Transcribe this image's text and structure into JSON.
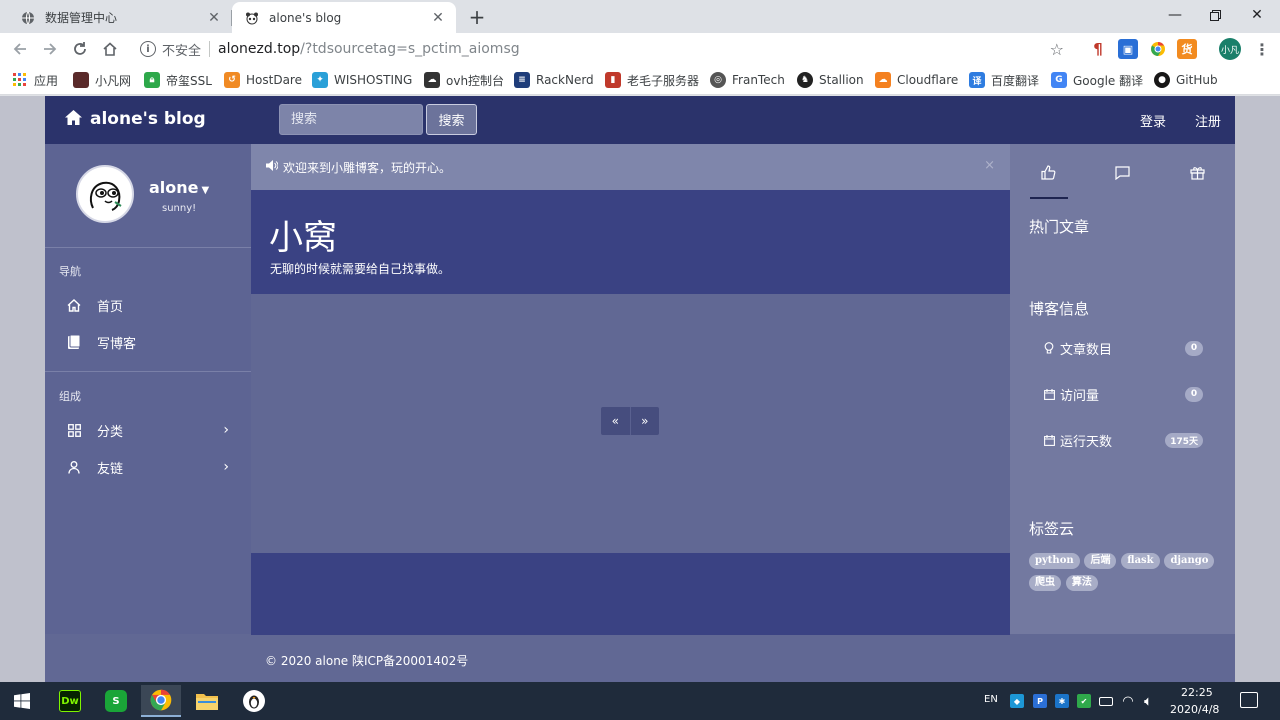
{
  "browser": {
    "tabs": [
      {
        "title": "数据管理中心",
        "icon": "globe-icon"
      },
      {
        "title": "alone's blog",
        "icon": "panda-icon"
      }
    ],
    "url": {
      "security_label": "不安全",
      "host": "alonezd.top",
      "path": "/?tdsourcetag=s_pctim_aiomsg"
    },
    "profile_initials": "小凡",
    "bookmarks": [
      {
        "label": "应用",
        "icon": "apps-grid-icon",
        "color": "#4285f4"
      },
      {
        "label": "小凡网",
        "icon": "site-icon",
        "color": "#5a2a2a"
      },
      {
        "label": "帝玺SSL",
        "icon": "lock-icon",
        "color": "#2da84a"
      },
      {
        "label": "HostDare",
        "icon": "flame-icon",
        "color": "#f08a24"
      },
      {
        "label": "WISHOSTING",
        "icon": "cloud-icon",
        "color": "#2aa0d8"
      },
      {
        "label": "ovh控制台",
        "icon": "cloud-icon",
        "color": "#333333"
      },
      {
        "label": "RackNerd",
        "icon": "server-icon",
        "color": "#1f3d7a"
      },
      {
        "label": "老毛子服务器",
        "icon": "bars-icon",
        "color": "#c0392b"
      },
      {
        "label": "FranTech",
        "icon": "globe-icon",
        "color": "#555555"
      },
      {
        "label": "Stallion",
        "icon": "horse-icon",
        "color": "#222222"
      },
      {
        "label": "Cloudflare",
        "icon": "cloud-icon",
        "color": "#f48120"
      },
      {
        "label": "百度翻译",
        "icon": "translate-icon",
        "color": "#2e7ce0"
      },
      {
        "label": "Google 翻译",
        "icon": "translate-icon",
        "color": "#4285f4"
      },
      {
        "label": "GitHub",
        "icon": "github-icon",
        "color": "#181717"
      }
    ]
  },
  "site": {
    "brand": "alone's blog",
    "search": {
      "placeholder": "搜索",
      "button": "搜索"
    },
    "auth": {
      "login": "登录",
      "register": "注册"
    },
    "profile": {
      "name": "alone",
      "motto": "sunny!"
    },
    "nav_sections": [
      {
        "title": "导航",
        "items": [
          {
            "label": "首页",
            "icon": "home-icon"
          },
          {
            "label": "写博客",
            "icon": "book-icon"
          }
        ]
      },
      {
        "title": "组成",
        "items": [
          {
            "label": "分类",
            "icon": "grid-icon",
            "expandable": true
          },
          {
            "label": "友链",
            "icon": "user-icon",
            "expandable": true
          }
        ]
      }
    ],
    "notice": "欢迎来到小雕博客，玩的开心。",
    "notice_close": "×",
    "hero": {
      "title": "小窝",
      "subtitle": "无聊的时候就需要给自己找事做。"
    },
    "pager": {
      "prev": "«",
      "next": "»"
    },
    "right_sidebar": {
      "tabs": [
        {
          "icon": "thumbs-up-icon"
        },
        {
          "icon": "comment-icon"
        },
        {
          "icon": "gift-icon"
        }
      ],
      "hot_title": "热门文章",
      "info_title": "博客信息",
      "stats": [
        {
          "label": "文章数目",
          "value": "0",
          "icon": "bulb-icon"
        },
        {
          "label": "访问量",
          "value": "0",
          "icon": "calendar-icon"
        },
        {
          "label": "运行天数",
          "value": "175天",
          "icon": "calendar-icon"
        }
      ],
      "tags_title": "标签云",
      "tags": [
        "python",
        "后端",
        "flask",
        "django",
        "爬虫",
        "算法"
      ]
    },
    "footer": "© 2020 alone 陕ICP备20001402号"
  },
  "taskbar": {
    "apps": [
      {
        "name": "dreamweaver",
        "label": "Dw",
        "color": "#072401"
      },
      {
        "name": "wps",
        "label": "S",
        "color": "#1aa538"
      },
      {
        "name": "chrome",
        "label": "",
        "color": "#db4437"
      },
      {
        "name": "file-explorer",
        "label": "",
        "color": "#f2c04c"
      },
      {
        "name": "penguin",
        "label": "",
        "color": "#ffffff"
      }
    ],
    "lang": "EN",
    "time": "22:25",
    "date": "2020/4/8"
  }
}
